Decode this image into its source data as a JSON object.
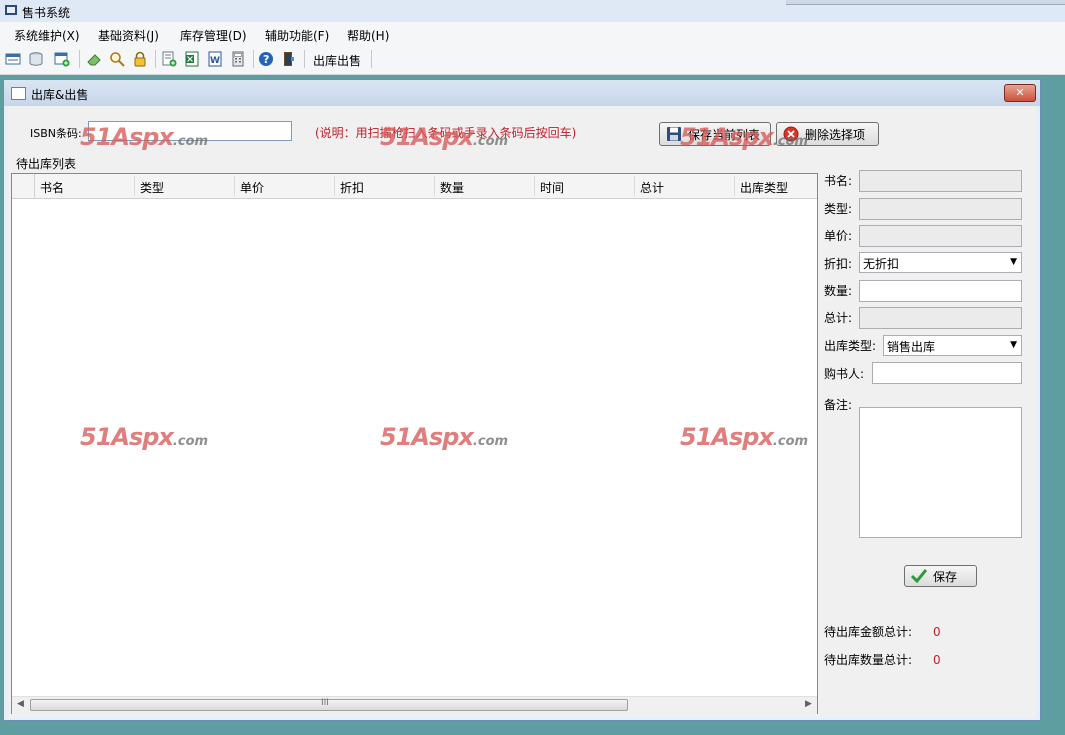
{
  "app": {
    "title": "售书系统"
  },
  "menu": [
    {
      "label": "系统维护(X)"
    },
    {
      "label": "基础资料(J)"
    },
    {
      "label": "库存管理(D)"
    },
    {
      "label": "辅助功能(F)"
    },
    {
      "label": "帮助(H)"
    }
  ],
  "toolbar": {
    "icons": [
      "list-icon",
      "database-icon",
      "add-window-icon",
      "eraser-icon",
      "search-icon",
      "lock-icon",
      "add-record-icon",
      "excel-icon",
      "word-icon",
      "calculator-icon",
      "help-icon",
      "exit-icon"
    ],
    "outbound_label": "出库出售"
  },
  "window": {
    "title": "出库&出售",
    "close_label": "✕"
  },
  "isbn": {
    "label": "ISBN条码:",
    "value": "",
    "hint": "(说明：用扫描枪扫入条码或手录入条码后按回车)"
  },
  "buttons": {
    "save_list": "保存当前列表",
    "delete_selected": "删除选择项",
    "save": "保存"
  },
  "list": {
    "title": "待出库列表",
    "columns": [
      "书名",
      "类型",
      "单价",
      "折扣",
      "数量",
      "时间",
      "总计",
      "出库类型"
    ],
    "rows": [],
    "scroll_grip": "III"
  },
  "form": {
    "book_name": {
      "label": "书名:",
      "value": ""
    },
    "type": {
      "label": "类型:",
      "value": ""
    },
    "price": {
      "label": "单价:",
      "value": ""
    },
    "discount": {
      "label": "折扣:",
      "value": "无折扣"
    },
    "quantity": {
      "label": "数量:",
      "value": ""
    },
    "total": {
      "label": "总计:",
      "value": ""
    },
    "outbound_type": {
      "label": "出库类型:",
      "value": "销售出库"
    },
    "buyer": {
      "label": "购书人:",
      "value": ""
    },
    "remark": {
      "label": "备注:",
      "value": ""
    }
  },
  "totals": {
    "amount_label": "待出库金额总计:",
    "amount_value": "0",
    "quantity_label": "待出库数量总计:",
    "quantity_value": "0"
  },
  "watermark": {
    "main": "51Aspx",
    "suffix": ".com"
  },
  "colors": {
    "desktop": "#5f9ea0",
    "hint": "#c0202a",
    "watermark": "#d85a5a"
  }
}
